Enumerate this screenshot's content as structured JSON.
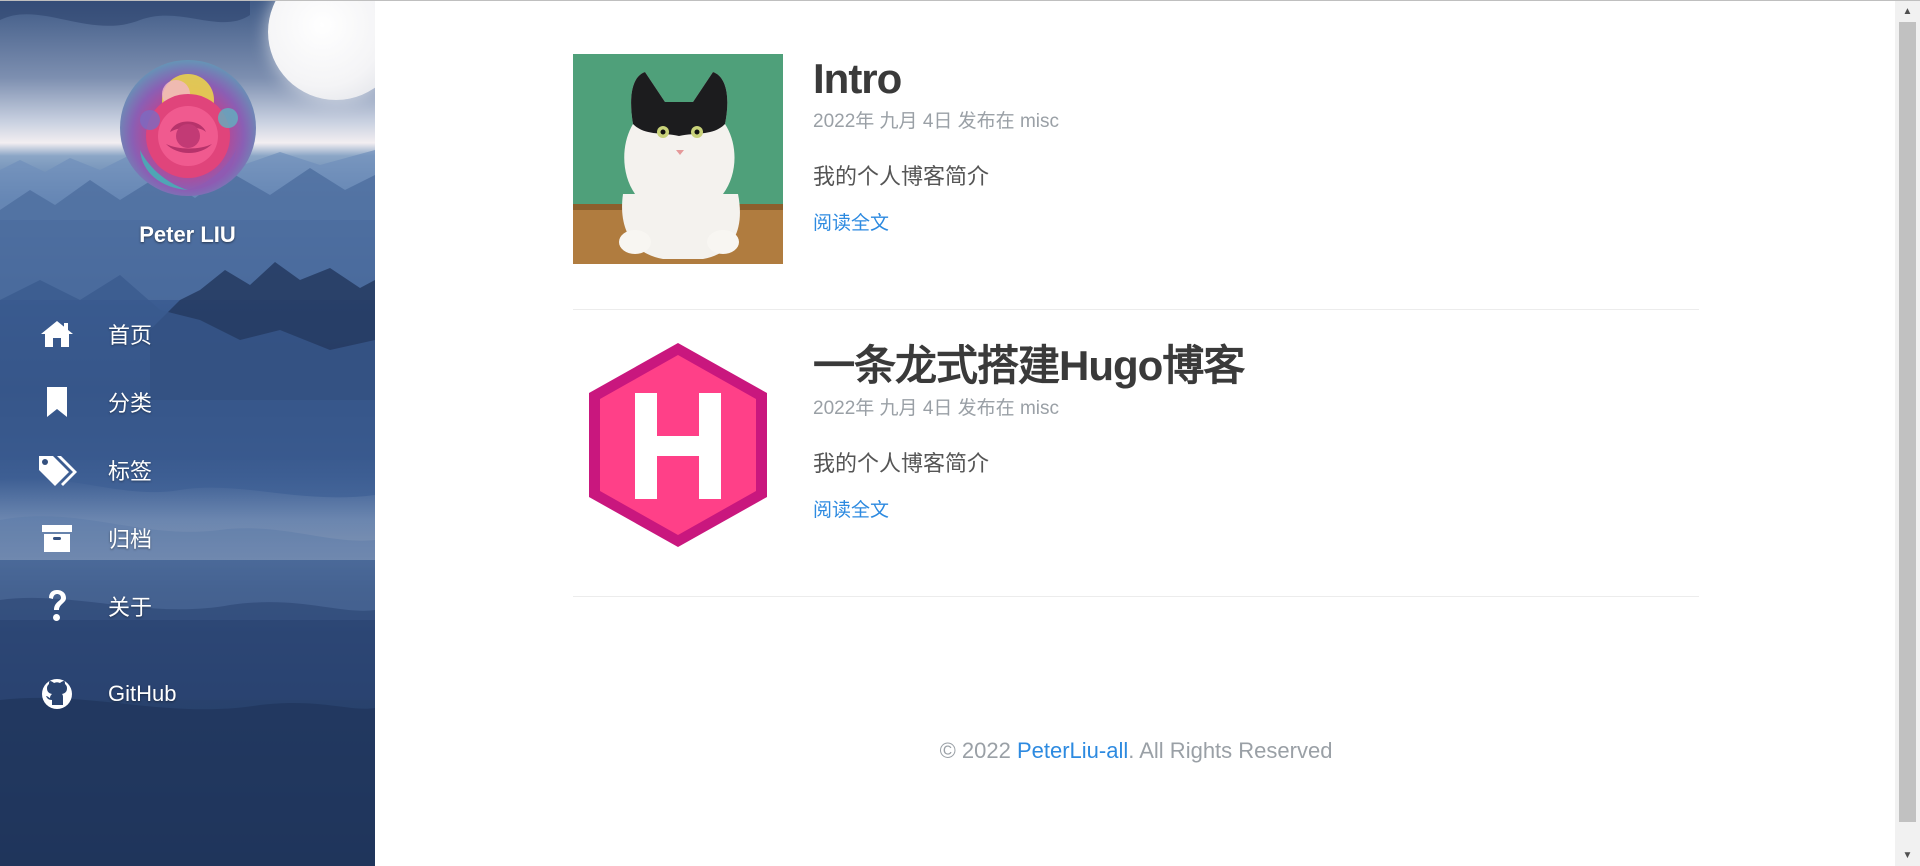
{
  "sidebar": {
    "author": "Peter LIU",
    "nav": [
      {
        "label": "首页",
        "icon": "home-icon"
      },
      {
        "label": "分类",
        "icon": "bookmark-icon"
      },
      {
        "label": "标签",
        "icon": "tags-icon"
      },
      {
        "label": "归档",
        "icon": "archive-icon"
      },
      {
        "label": "关于",
        "icon": "question-icon"
      }
    ],
    "github": {
      "label": "GitHub",
      "icon": "github-icon"
    }
  },
  "posts": [
    {
      "title": "Intro",
      "meta": "2022年 九月 4日 发布在 misc",
      "summary": "我的个人博客简介",
      "read_more": "阅读全文",
      "thumbnail": "cat-photo"
    },
    {
      "title": "一条龙式搭建Hugo博客",
      "meta": "2022年 九月 4日 发布在 misc",
      "summary": "我的个人博客简介",
      "read_more": "阅读全文",
      "thumbnail": "hugo-logo"
    }
  ],
  "footer": {
    "prefix": "© 2022 ",
    "link": "PeterLiu-all",
    "suffix": ". All Rights Reserved"
  },
  "colors": {
    "link": "#2d8ae0",
    "meta": "#9aa0a6",
    "title": "#3a3a3a",
    "hugo_pink": "#ff4088"
  }
}
